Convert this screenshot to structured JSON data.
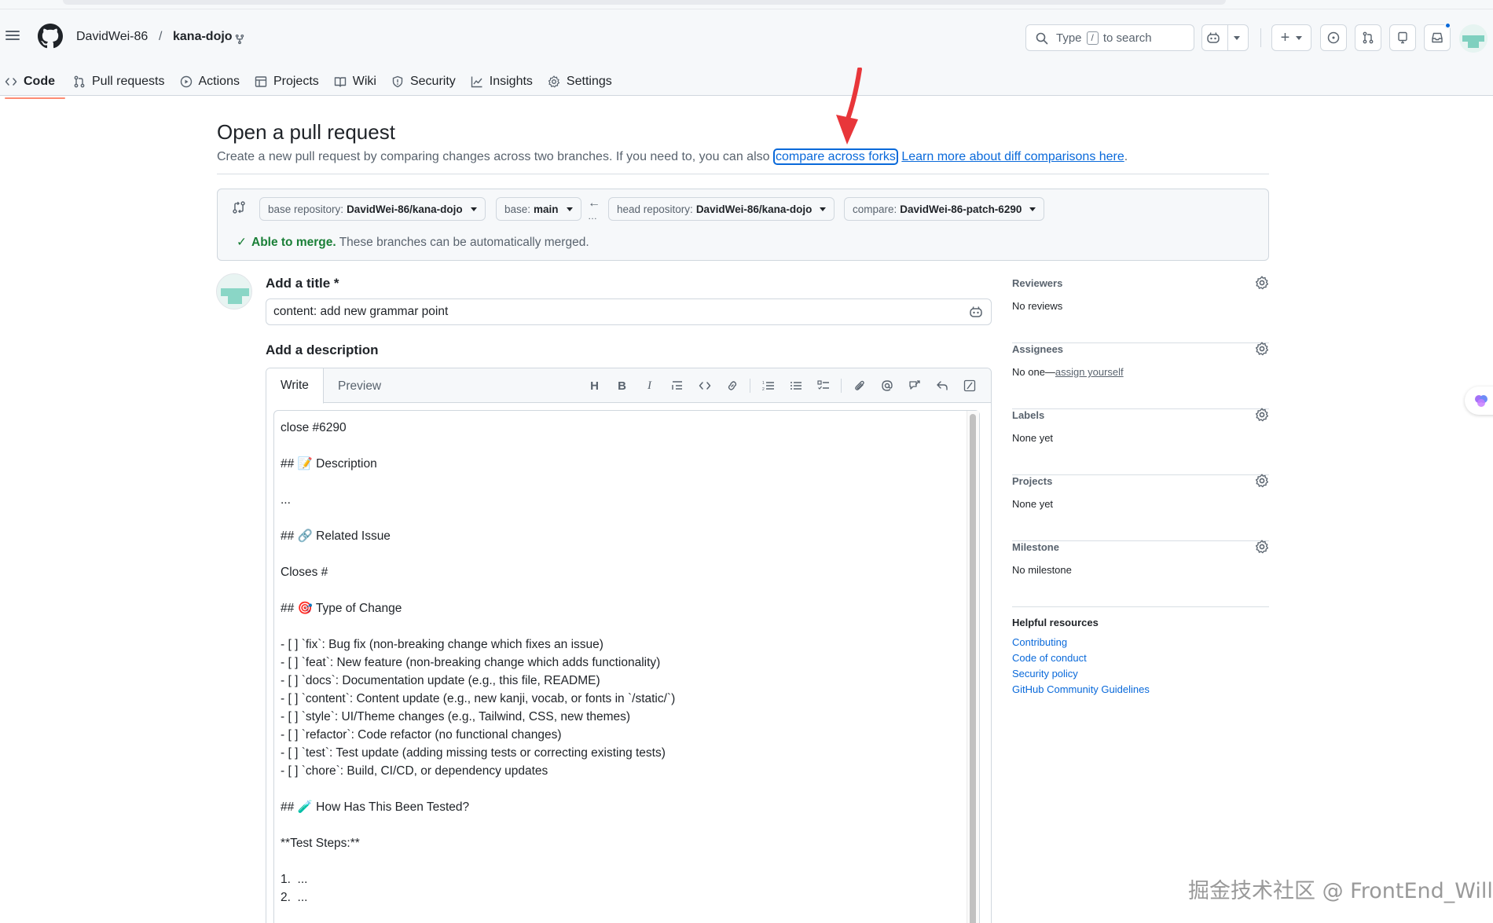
{
  "header": {
    "owner": "DavidWei-86",
    "separator": "/",
    "repo": "kana-dojo",
    "search_placeholder_pre": "Type",
    "search_key": "/",
    "search_placeholder_post": "to search"
  },
  "tabs": [
    {
      "label": "Code",
      "icon": "code-icon",
      "active": true
    },
    {
      "label": "Pull requests",
      "icon": "git-pull-request-icon"
    },
    {
      "label": "Actions",
      "icon": "play-icon"
    },
    {
      "label": "Projects",
      "icon": "table-icon"
    },
    {
      "label": "Wiki",
      "icon": "book-icon"
    },
    {
      "label": "Security",
      "icon": "shield-icon"
    },
    {
      "label": "Insights",
      "icon": "graph-icon"
    },
    {
      "label": "Settings",
      "icon": "gear-icon"
    }
  ],
  "page": {
    "title": "Open a pull request",
    "subtitle_text": "Create a new pull request by comparing changes across two branches. If you need to, you can also ",
    "compare_forks_link": "compare across forks",
    "learn_more_link": "Learn more about diff comparisons here",
    "subtitle_end": "."
  },
  "compare": {
    "base_repo_label": "base repository:",
    "base_repo_value": "DavidWei-86/kana-dojo",
    "base_label": "base:",
    "base_value": "main",
    "head_repo_label": "head repository:",
    "head_repo_value": "DavidWei-86/kana-dojo",
    "compare_label": "compare:",
    "compare_value": "DavidWei-86-patch-6290",
    "merge_ok": "Able to merge.",
    "merge_text": "These branches can be automatically merged."
  },
  "form": {
    "title_label": "Add a title *",
    "title_value": "content: add new grammar point",
    "desc_label": "Add a description",
    "tab_write": "Write",
    "tab_preview": "Preview",
    "description": "close #6290\n\n## 📝 Description\n\n...\n\n## 🔗 Related Issue\n\nCloses #\n\n## 🎯 Type of Change\n\n- [ ] `fix`: Bug fix (non-breaking change which fixes an issue)\n- [ ] `feat`: New feature (non-breaking change which adds functionality)\n- [ ] `docs`: Documentation update (e.g., this file, README)\n- [ ] `content`: Content update (e.g., new kanji, vocab, or fonts in `/static/`)\n- [ ] `style`: UI/Theme changes (e.g., Tailwind, CSS, new themes)\n- [ ] `refactor`: Code refactor (no functional changes)\n- [ ] `test`: Test update (adding missing tests or correcting existing tests)\n- [ ] `chore`: Build, CI/CD, or dependency updates\n\n## 🧪 How Has This Been Tested?\n\n**Test Steps:**\n\n1.  ...\n2.  ..."
  },
  "sidebar": {
    "reviewers_title": "Reviewers",
    "reviewers_value": "No reviews",
    "assignees_title": "Assignees",
    "assignees_value": "No one—",
    "assignees_link": "assign yourself",
    "labels_title": "Labels",
    "labels_value": "None yet",
    "projects_title": "Projects",
    "projects_value": "None yet",
    "milestone_title": "Milestone",
    "milestone_value": "No milestone",
    "help_title": "Helpful resources",
    "help_links": [
      "Contributing",
      "Code of conduct",
      "Security policy",
      "GitHub Community Guidelines"
    ]
  },
  "watermark": "掘金技术社区 @ FrontEnd_Will",
  "colors": {
    "accent": "#0969da",
    "success": "#1a7f37",
    "tab_underline": "#fd8c73",
    "annotation_arrow": "#e8363a"
  }
}
